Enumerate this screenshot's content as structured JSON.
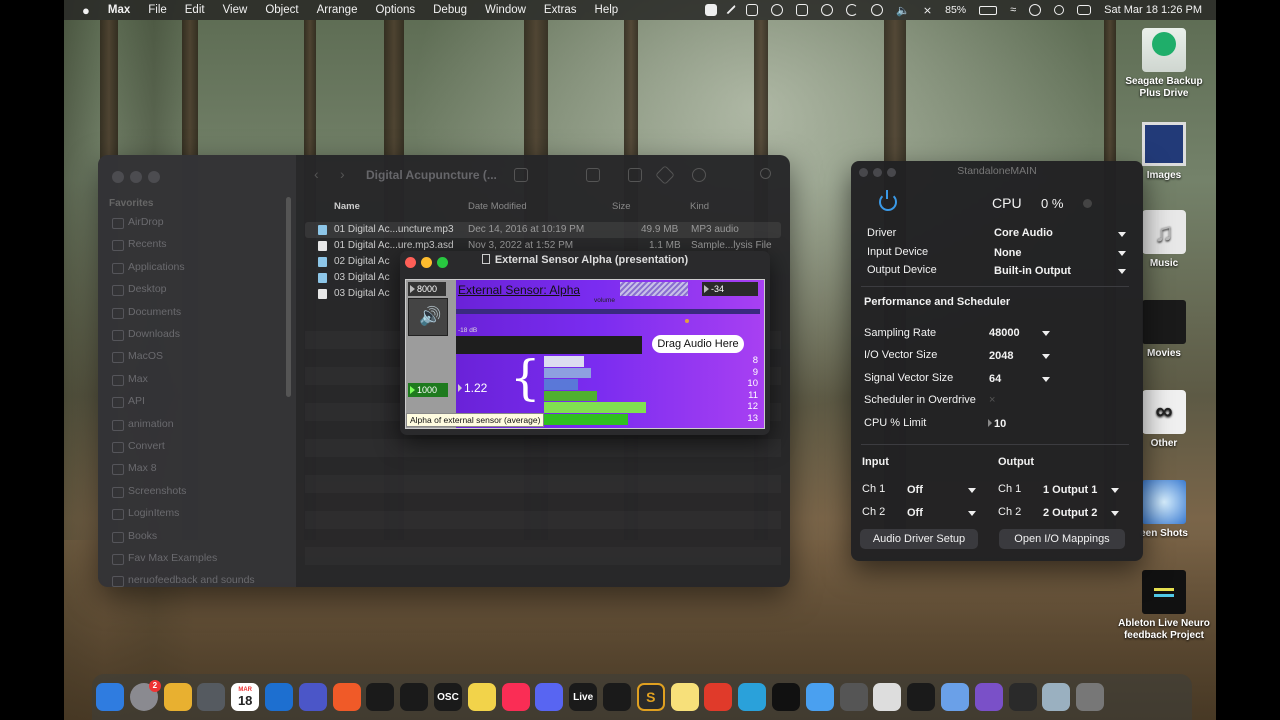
{
  "menubar": {
    "apple": "",
    "app": "Max",
    "menus": [
      "File",
      "Edit",
      "View",
      "Object",
      "Arrange",
      "Options",
      "Debug",
      "Window",
      "Extras",
      "Help"
    ],
    "status_icons": [
      "b-icon",
      "pen-icon",
      "notification-icon",
      "circle-icon",
      "x-box-icon",
      "play-icon",
      "moon-icon",
      "info-icon",
      "volume-icon",
      "bluetooth-off-icon"
    ],
    "battery": "85%",
    "datetime": "Sat Mar 18  1:26 PM"
  },
  "finder": {
    "title": "Digital Acupuncture (...",
    "sidebar": {
      "heading": "Favorites",
      "items": [
        "AirDrop",
        "Recents",
        "Applications",
        "Desktop",
        "Documents",
        "Downloads",
        "MacOS",
        "Max",
        "API",
        "animation",
        "Convert",
        "Max 8",
        "Screenshots",
        "LoginItems",
        "Books",
        "Fav Max Examples",
        "neruofeedback and sounds"
      ]
    },
    "columns": {
      "name": "Name",
      "date": "Date Modified",
      "size": "Size",
      "kind": "Kind"
    },
    "files": [
      {
        "name": "01 Digital Ac...uncture.mp3",
        "date": "Dec 14, 2016 at 10:19 PM",
        "size": "49.9 MB",
        "kind": "MP3 audio",
        "type": "mp3"
      },
      {
        "name": "01 Digital Ac...ure.mp3.asd",
        "date": "Nov 3, 2022 at 1:52 PM",
        "size": "1.1 MB",
        "kind": "Sample...lysis File",
        "type": "doc"
      },
      {
        "name": "02 Digital Ac",
        "date": "",
        "size": "",
        "kind": "",
        "type": "mp3"
      },
      {
        "name": "03 Digital Ac",
        "date": "",
        "size": "",
        "kind": "",
        "type": "mp3"
      },
      {
        "name": "03 Digital Ac",
        "date": "",
        "size": "",
        "kind": "",
        "type": "doc"
      }
    ]
  },
  "presentation": {
    "title": "External Sensor Alpha (presentation)",
    "max_value": "8000",
    "min_value": "1000",
    "heading": "External Sensor: Alpha",
    "volume_label": "volume",
    "volume_value": "-34",
    "db_label": "-18 dB",
    "drag_label": "Drag Audio Here",
    "average": "1.22",
    "brace": "{",
    "tooltip": "Alpha of external sensor (average)",
    "scale": [
      "8",
      "9",
      "10",
      "11",
      "12",
      "13"
    ],
    "bars": [
      {
        "level": 0.13,
        "color": "#dcdcf0"
      },
      {
        "level": 0.15,
        "color": "#8ea0e0"
      },
      {
        "level": 0.11,
        "color": "#5a78d8"
      },
      {
        "level": 0.17,
        "color": "#50b030"
      },
      {
        "level": 0.33,
        "color": "#80e050"
      },
      {
        "level": 0.27,
        "color": "#30c020"
      }
    ]
  },
  "standalone": {
    "title": "StandaloneMAIN",
    "cpu_label": "CPU",
    "cpu_value": "0 %",
    "driver_label": "Driver",
    "driver": "Core Audio",
    "input_device_label": "Input Device",
    "input_device": "None",
    "output_device_label": "Output Device",
    "output_device": "Built-in Output",
    "perf_heading": "Performance and Scheduler",
    "sampling_rate_label": "Sampling Rate",
    "sampling_rate": "48000",
    "io_vector_label": "I/O Vector Size",
    "io_vector": "2048",
    "signal_vector_label": "Signal Vector Size",
    "signal_vector": "64",
    "overdrive_label": "Scheduler in Overdrive",
    "overdrive_mark": "×",
    "cpu_limit_label": "CPU % Limit",
    "cpu_limit": "10",
    "input_heading": "Input",
    "output_heading": "Output",
    "in_ch1_label": "Ch 1",
    "in_ch1": "Off",
    "in_ch2_label": "Ch 2",
    "in_ch2": "Off",
    "out_ch1_label": "Ch 1",
    "out_ch1": "1 Output 1",
    "out_ch2_label": "Ch 2",
    "out_ch2": "2 Output 2",
    "driver_setup_button": "Audio Driver Setup",
    "io_mappings_button": "Open I/O Mappings"
  },
  "desktop_icons": [
    {
      "label": "Seagate Backup Plus Drive",
      "icon": "drive-icon"
    },
    {
      "label": "Images",
      "icon": "folder-icon"
    },
    {
      "label": "Music",
      "icon": "music-icon"
    },
    {
      "label": "Movies",
      "icon": "folder-icon"
    },
    {
      "label": "Other",
      "icon": "app-icon"
    },
    {
      "label": "een Shots",
      "icon": "folder-icon"
    },
    {
      "label": "Ableton Live Neuro feedback Project",
      "icon": "project-icon"
    }
  ],
  "dock": {
    "calendar_month": "MAR",
    "calendar_day": "18",
    "osc_label": "OSC",
    "live_label": "Live",
    "s_label": "S",
    "settings_badge": "2",
    "colors": [
      "#2f7ce0",
      "#8a8a90",
      "#e8b030",
      "#555a60",
      "#ffffff",
      "#1d6fd0",
      "#4b56c8",
      "#f05a28",
      "#1a1a1a",
      "#1a1a1a",
      "#1a1a1a",
      "#f2d34a",
      "#fa2d55",
      "#5865f2",
      "#1a1a1a",
      "#1a1a1a",
      "#2a2a2a",
      "#f7e07a",
      "#e03a2a",
      "#2aa1da",
      "#111111",
      "#4aa0f0",
      "#555555",
      "#dddddd",
      "#1a1a1a",
      "#6aa0e8",
      "#7a50c8",
      "#2a2a2a",
      "#9ab0c0",
      "#777777"
    ]
  }
}
